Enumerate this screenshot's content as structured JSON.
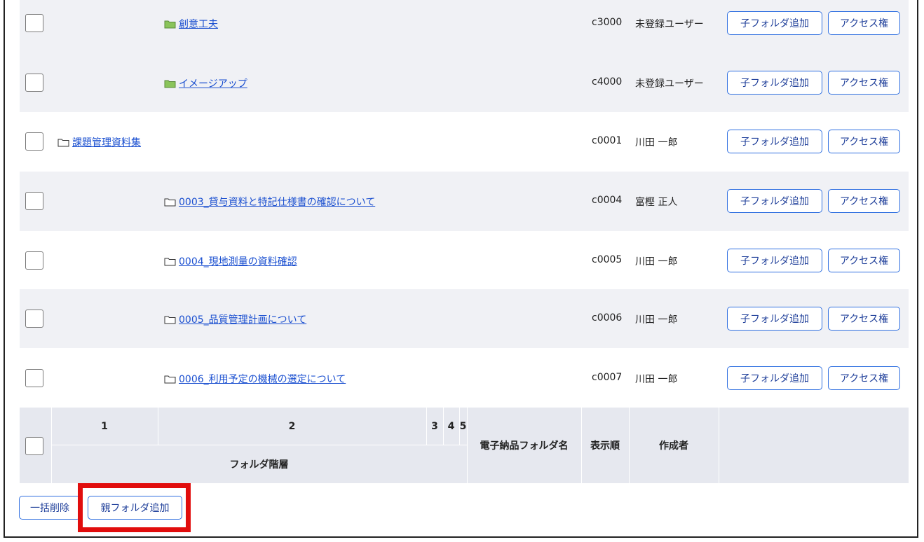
{
  "rows": [
    {
      "name": "創意工夫",
      "order": "c3000",
      "creator": "未登録ユーザー",
      "level": 2,
      "icon": "folder-green-icon"
    },
    {
      "name": "イメージアップ",
      "order": "c4000",
      "creator": "未登録ユーザー",
      "level": 2,
      "icon": "folder-green-icon"
    },
    {
      "name": "課題管理資料集",
      "order": "c0001",
      "creator": "川田 一郎",
      "level": 1,
      "icon": "folder-outline-icon"
    },
    {
      "name": "0003_貸与資料と特記仕様書の確認について",
      "order": "c0004",
      "creator": "富樫 正人",
      "level": 2,
      "icon": "folder-outline-icon"
    },
    {
      "name": "0004_現地測量の資料確認",
      "order": "c0005",
      "creator": "川田 一郎",
      "level": 2,
      "icon": "folder-outline-icon"
    },
    {
      "name": "0005_品質管理計画について",
      "order": "c0006",
      "creator": "川田 一郎",
      "level": 2,
      "icon": "folder-outline-icon"
    },
    {
      "name": "0006_利用予定の機械の選定について",
      "order": "c0007",
      "creator": "川田 一郎",
      "level": 2,
      "icon": "folder-outline-icon"
    }
  ],
  "row_buttons": {
    "add_child": "子フォルダ追加",
    "access": "アクセス権"
  },
  "header": {
    "level1": "1",
    "level2": "2",
    "level3": "3",
    "level4": "4",
    "level5": "5",
    "folder_hierarchy": "フォルダ階層",
    "delivery_folder_name": "電子納品フォルダ名",
    "display_order": "表示順",
    "creator": "作成者"
  },
  "footer": {
    "bulk_delete": "一括削除",
    "add_parent": "親フォルダ追加"
  },
  "colors": {
    "accent": "#2f6fe0",
    "link": "#1a4fd0",
    "highlight": "#e10d0d",
    "folder_green": "#8ac45a"
  }
}
